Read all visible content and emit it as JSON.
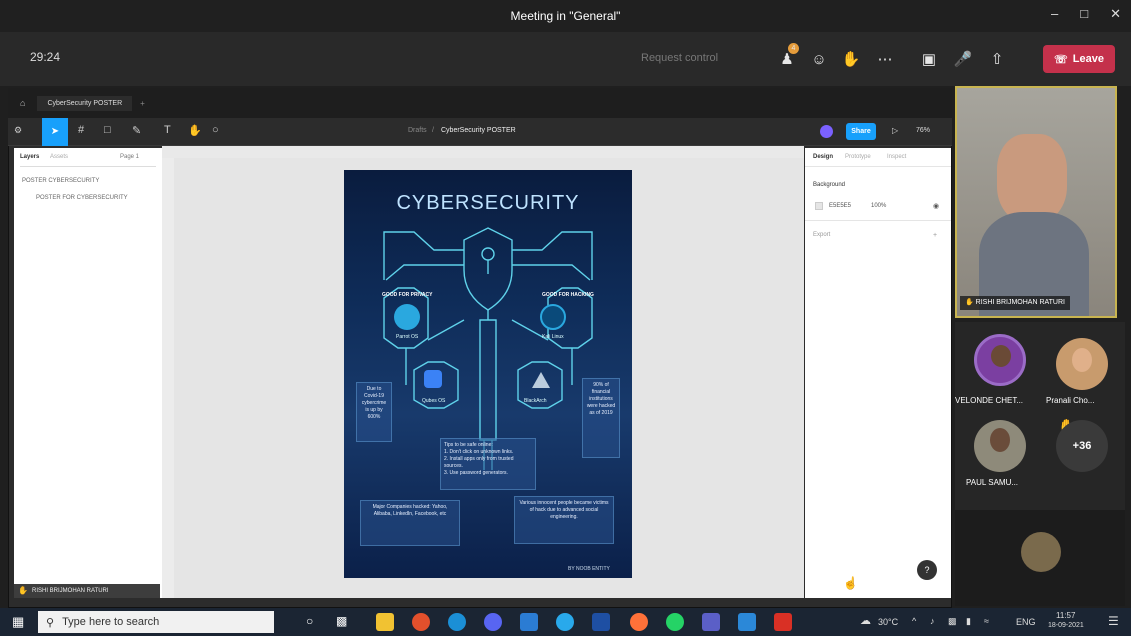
{
  "window": {
    "title": "Meeting in \"General\""
  },
  "meeting": {
    "timer": "29:24",
    "request_control": "Request control",
    "leave_label": "Leave",
    "notification_count": "4"
  },
  "figma": {
    "tab_title": "CyberSecurity POSTER",
    "breadcrumb_parent": "Drafts",
    "breadcrumb_sep": "/",
    "file_title": "CyberSecurity POSTER",
    "share_label": "Share",
    "zoom": "76%",
    "layers_tab": "Layers",
    "assets_tab": "Assets",
    "page_label": "Page 1",
    "layer_items": [
      "POSTER CYBERSECURITY",
      "POSTER FOR CYBERSECURITY"
    ],
    "props_tabs": [
      "Design",
      "Prototype",
      "Inspect"
    ],
    "background_label": "Background",
    "bg_hex": "E5E5E5",
    "bg_opacity": "100%",
    "export_label": "Export",
    "presenter_tag": "RISHI BRIJMOHAN RATURI"
  },
  "poster": {
    "title": "CYBERSECURITY",
    "privacy_label": "GOOD FOR PRIVACY",
    "hacking_label": "GOOD FOR HACKING",
    "os": [
      "Parrot OS",
      "Kali Linux",
      "Qubes OS",
      "BlackArch"
    ],
    "left_stat": "Due to Covid-19 cybercrime is up by 600%",
    "right_stat": "90% of financial institutions were hacked as of 2019",
    "tips_title": "Tips to be safe online:",
    "tips": [
      "1. Don't click on unknown links.",
      "2. Install apps only from trusted sources.",
      "3. Use password generators."
    ],
    "companies": "Major Companies hacked: Yahoo, Alibaba, LinkedIn, Facebook, etc",
    "innocent": "Various innocent people became victims of hack due to advanced social engineering.",
    "credit": "BY NOOB ENTITY"
  },
  "participants": {
    "speaker": "RISHI BRIJMOHAN RATURI",
    "p1": "VELONDE CHET...",
    "p2": "Pranali Cho...",
    "p3": "PAUL SAMU...",
    "more": "+36"
  },
  "taskbar": {
    "search_placeholder": "Type here to search",
    "weather": "30°C",
    "lang": "ENG",
    "time": "11:57",
    "date": "18-09-2021"
  },
  "colors": {
    "leave": "#c4314b",
    "figma_blue": "#18a0fb",
    "speaker_border": "#c8b450"
  }
}
